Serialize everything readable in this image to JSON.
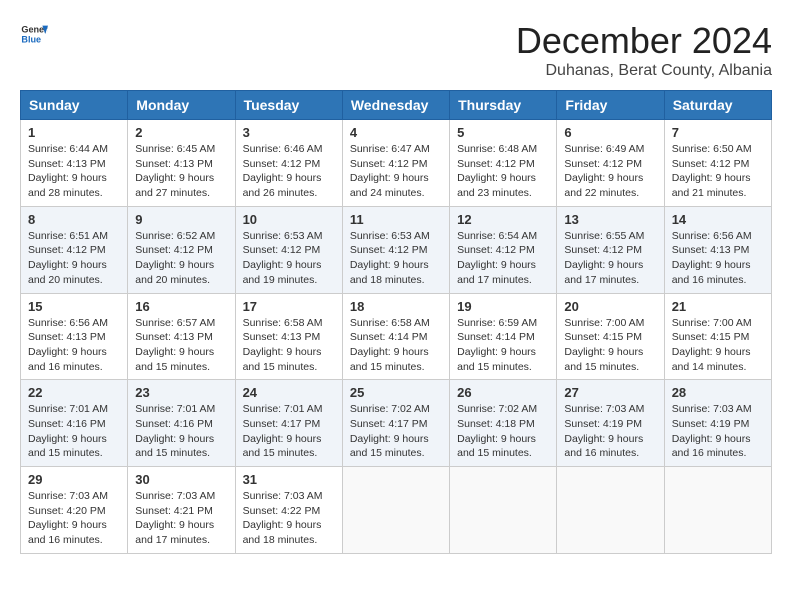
{
  "header": {
    "logo_general": "General",
    "logo_blue": "Blue",
    "month_title": "December 2024",
    "subtitle": "Duhanas, Berat County, Albania"
  },
  "weekdays": [
    "Sunday",
    "Monday",
    "Tuesday",
    "Wednesday",
    "Thursday",
    "Friday",
    "Saturday"
  ],
  "weeks": [
    [
      {
        "day": "1",
        "sunrise": "6:44 AM",
        "sunset": "4:13 PM",
        "daylight": "9 hours and 28 minutes."
      },
      {
        "day": "2",
        "sunrise": "6:45 AM",
        "sunset": "4:13 PM",
        "daylight": "9 hours and 27 minutes."
      },
      {
        "day": "3",
        "sunrise": "6:46 AM",
        "sunset": "4:12 PM",
        "daylight": "9 hours and 26 minutes."
      },
      {
        "day": "4",
        "sunrise": "6:47 AM",
        "sunset": "4:12 PM",
        "daylight": "9 hours and 24 minutes."
      },
      {
        "day": "5",
        "sunrise": "6:48 AM",
        "sunset": "4:12 PM",
        "daylight": "9 hours and 23 minutes."
      },
      {
        "day": "6",
        "sunrise": "6:49 AM",
        "sunset": "4:12 PM",
        "daylight": "9 hours and 22 minutes."
      },
      {
        "day": "7",
        "sunrise": "6:50 AM",
        "sunset": "4:12 PM",
        "daylight": "9 hours and 21 minutes."
      }
    ],
    [
      {
        "day": "8",
        "sunrise": "6:51 AM",
        "sunset": "4:12 PM",
        "daylight": "9 hours and 20 minutes."
      },
      {
        "day": "9",
        "sunrise": "6:52 AM",
        "sunset": "4:12 PM",
        "daylight": "9 hours and 20 minutes."
      },
      {
        "day": "10",
        "sunrise": "6:53 AM",
        "sunset": "4:12 PM",
        "daylight": "9 hours and 19 minutes."
      },
      {
        "day": "11",
        "sunrise": "6:53 AM",
        "sunset": "4:12 PM",
        "daylight": "9 hours and 18 minutes."
      },
      {
        "day": "12",
        "sunrise": "6:54 AM",
        "sunset": "4:12 PM",
        "daylight": "9 hours and 17 minutes."
      },
      {
        "day": "13",
        "sunrise": "6:55 AM",
        "sunset": "4:12 PM",
        "daylight": "9 hours and 17 minutes."
      },
      {
        "day": "14",
        "sunrise": "6:56 AM",
        "sunset": "4:13 PM",
        "daylight": "9 hours and 16 minutes."
      }
    ],
    [
      {
        "day": "15",
        "sunrise": "6:56 AM",
        "sunset": "4:13 PM",
        "daylight": "9 hours and 16 minutes."
      },
      {
        "day": "16",
        "sunrise": "6:57 AM",
        "sunset": "4:13 PM",
        "daylight": "9 hours and 15 minutes."
      },
      {
        "day": "17",
        "sunrise": "6:58 AM",
        "sunset": "4:13 PM",
        "daylight": "9 hours and 15 minutes."
      },
      {
        "day": "18",
        "sunrise": "6:58 AM",
        "sunset": "4:14 PM",
        "daylight": "9 hours and 15 minutes."
      },
      {
        "day": "19",
        "sunrise": "6:59 AM",
        "sunset": "4:14 PM",
        "daylight": "9 hours and 15 minutes."
      },
      {
        "day": "20",
        "sunrise": "7:00 AM",
        "sunset": "4:15 PM",
        "daylight": "9 hours and 15 minutes."
      },
      {
        "day": "21",
        "sunrise": "7:00 AM",
        "sunset": "4:15 PM",
        "daylight": "9 hours and 14 minutes."
      }
    ],
    [
      {
        "day": "22",
        "sunrise": "7:01 AM",
        "sunset": "4:16 PM",
        "daylight": "9 hours and 15 minutes."
      },
      {
        "day": "23",
        "sunrise": "7:01 AM",
        "sunset": "4:16 PM",
        "daylight": "9 hours and 15 minutes."
      },
      {
        "day": "24",
        "sunrise": "7:01 AM",
        "sunset": "4:17 PM",
        "daylight": "9 hours and 15 minutes."
      },
      {
        "day": "25",
        "sunrise": "7:02 AM",
        "sunset": "4:17 PM",
        "daylight": "9 hours and 15 minutes."
      },
      {
        "day": "26",
        "sunrise": "7:02 AM",
        "sunset": "4:18 PM",
        "daylight": "9 hours and 15 minutes."
      },
      {
        "day": "27",
        "sunrise": "7:03 AM",
        "sunset": "4:19 PM",
        "daylight": "9 hours and 16 minutes."
      },
      {
        "day": "28",
        "sunrise": "7:03 AM",
        "sunset": "4:19 PM",
        "daylight": "9 hours and 16 minutes."
      }
    ],
    [
      {
        "day": "29",
        "sunrise": "7:03 AM",
        "sunset": "4:20 PM",
        "daylight": "9 hours and 16 minutes."
      },
      {
        "day": "30",
        "sunrise": "7:03 AM",
        "sunset": "4:21 PM",
        "daylight": "9 hours and 17 minutes."
      },
      {
        "day": "31",
        "sunrise": "7:03 AM",
        "sunset": "4:22 PM",
        "daylight": "9 hours and 18 minutes."
      },
      null,
      null,
      null,
      null
    ]
  ],
  "labels": {
    "sunrise": "Sunrise:",
    "sunset": "Sunset:",
    "daylight": "Daylight:"
  }
}
